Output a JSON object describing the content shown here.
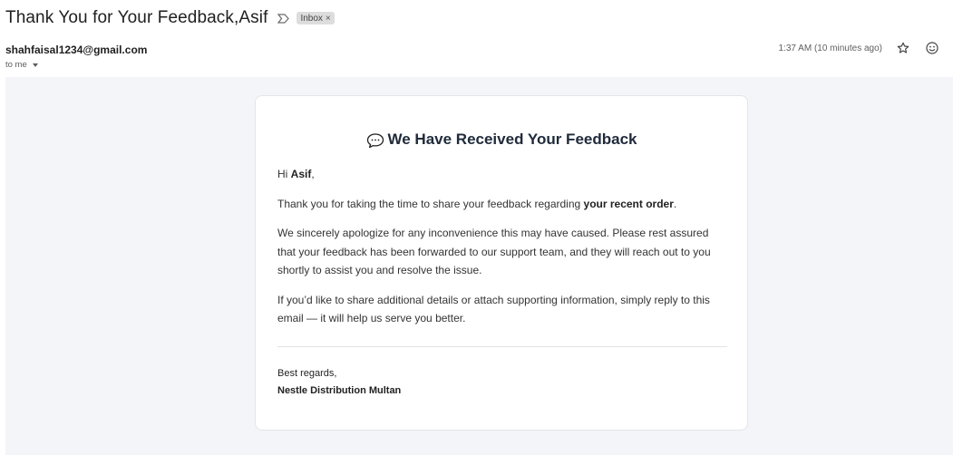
{
  "email": {
    "subject": "Thank You for Your Feedback,Asif",
    "label": "Inbox",
    "label_remove": "×",
    "sender": "shahfaisal1234@gmail.com",
    "to_line": "to me",
    "timestamp": "1:37 AM (10 minutes ago)"
  },
  "icons": {
    "important": "important-marker-icon",
    "star": "star-icon",
    "emoji": "emoji-react-icon",
    "speech": "speech-balloon-icon"
  },
  "body": {
    "heading": "We Have Received Your Feedback",
    "greeting_prefix": "Hi ",
    "greeting_name": "Asif",
    "greeting_suffix": ",",
    "para1_prefix": "Thank you for taking the time to share your feedback regarding ",
    "para1_bold": "your recent order",
    "para1_suffix": ".",
    "para2": "We sincerely apologize for any inconvenience this may have caused. Please rest assured that your feedback has been forwarded to our support team, and they will reach out to you shortly to assist you and resolve the issue.",
    "para3": "If you’d like to share additional details or attach supporting information, simply reply to this email — it will help us serve you better.",
    "signoff": "Best regards,",
    "org": "Nestle Distribution Multan"
  },
  "colors": {
    "background_panel": "#f4f5f8",
    "heading": "#1f2a3a"
  }
}
